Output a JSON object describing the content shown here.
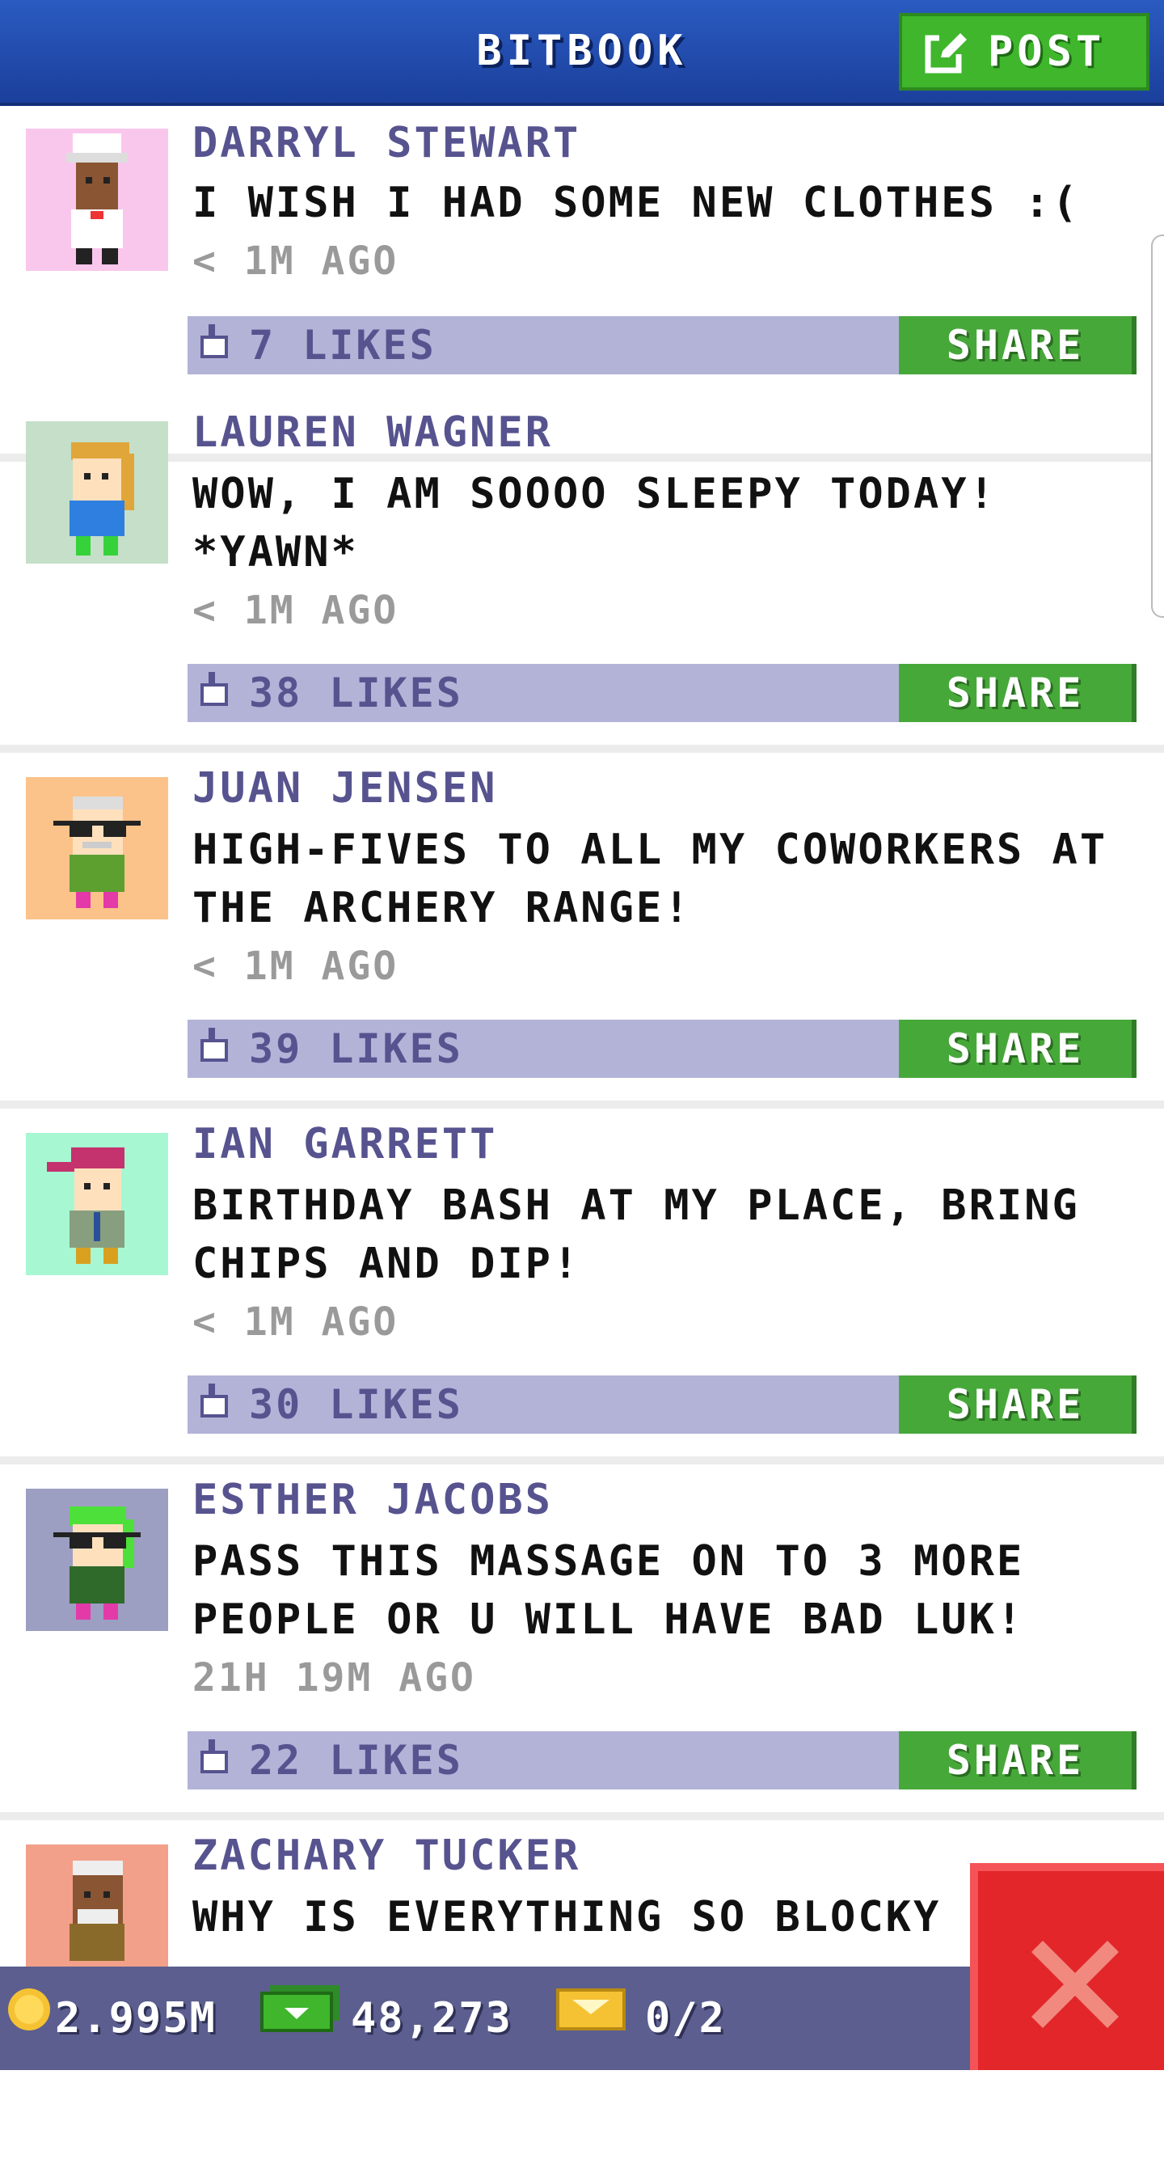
{
  "header": {
    "title": "BITBOOK",
    "post_label": "POST"
  },
  "posts": [
    {
      "author": "DARRYL STEWART",
      "message": "I WISH I HAD SOME NEW CLOTHES :(",
      "time": "< 1M AGO",
      "likes": "7 LIKES",
      "share": "SHARE",
      "avatar_bg": "#f9c7ec",
      "avatar": "chef-avatar-icon"
    },
    {
      "author": "LAUREN WAGNER",
      "message": "WOW, I AM SOOOO SLEEPY TODAY! *YAWN*",
      "time": "< 1M AGO",
      "likes": "38 LIKES",
      "share": "SHARE",
      "avatar_bg": "#c5dfc9",
      "avatar": "blonde-person-avatar-icon"
    },
    {
      "author": "JUAN JENSEN",
      "message": "HIGH-FIVES TO ALL MY COWORKERS AT THE ARCHERY RANGE!",
      "time": "< 1M AGO",
      "likes": "39 LIKES",
      "share": "SHARE",
      "avatar_bg": "#fbc28a",
      "avatar": "glasses-man-avatar-icon"
    },
    {
      "author": "IAN GARRETT",
      "message": "BIRTHDAY BASH AT MY PLACE, BRING CHIPS AND DIP!",
      "time": "< 1M AGO",
      "likes": "30 LIKES",
      "share": "SHARE",
      "avatar_bg": "#a7f7d3",
      "avatar": "cap-man-avatar-icon"
    },
    {
      "author": "ESTHER JACOBS",
      "message": "PASS THIS MASSAGE ON TO 3 MORE PEOPLE OR U WILL HAVE BAD LUK!",
      "time": "21H 19M AGO",
      "likes": "22 LIKES",
      "share": "SHARE",
      "avatar_bg": "#9c9ec2",
      "avatar": "green-hair-avatar-icon"
    },
    {
      "author": "ZACHARY TUCKER",
      "message": "WHY IS EVERYTHING SO BLOCKY",
      "time": "",
      "likes": "",
      "share": "",
      "avatar_bg": "#f2a08a",
      "avatar": "old-man-avatar-icon"
    }
  ],
  "status": {
    "coins": "2.995M",
    "bux": "48,273",
    "tickets": "0/2"
  },
  "colors": {
    "header": "#1f48a8",
    "post_button": "#3fb62c",
    "likes_bar": "#b3b3d8",
    "share_button": "#47a83a",
    "author": "#56538f",
    "status_bar": "#5b5e8e",
    "close_button": "#e2262a"
  }
}
